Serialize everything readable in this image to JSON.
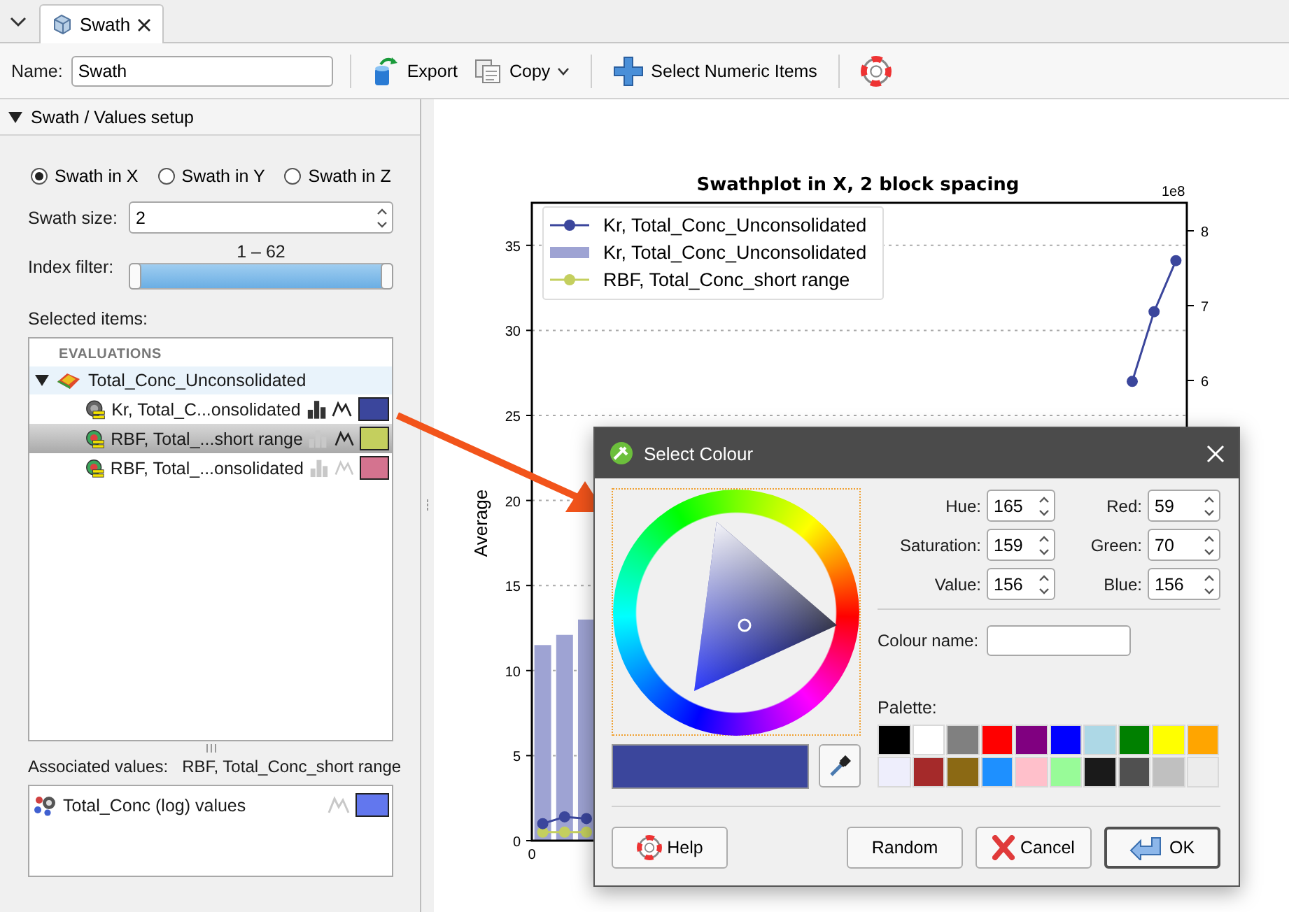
{
  "tab_bar": {
    "tabs": [
      {
        "label": "Swath",
        "selected": true
      }
    ]
  },
  "toolbar": {
    "name_label": "Name:",
    "name_value": "Swath",
    "buttons": [
      {
        "kind": "export",
        "label": "Export"
      },
      {
        "kind": "copy",
        "label": "Copy"
      },
      {
        "kind": "add",
        "label": "Select Numeric Items"
      },
      {
        "kind": "help"
      }
    ]
  },
  "setup_panel": {
    "title": "Swath / Values setup",
    "expanded": true,
    "axis_options": [
      {
        "label": "Swath in X",
        "selected": true
      },
      {
        "label": "Swath in Y",
        "selected": false
      },
      {
        "label": "Swath in Z",
        "selected": false
      }
    ],
    "swath_size": {
      "label": "Swath size:",
      "value": "2"
    },
    "index_filter": {
      "label": "Index filter:",
      "range": "1 – 62",
      "level": 1
    },
    "selected_items": {
      "label": "Selected items:",
      "section": "EVALUATIONS",
      "groups": [
        {
          "label": "Total_Conc_Unconsolidated",
          "expanded": true,
          "children": [
            {
              "label": "Kr, Total_C...onsolidated",
              "kind": "kriging",
              "selected": false,
              "histogram": true,
              "line": true,
              "color": "#3b469c"
            },
            {
              "label": "RBF, Total_...short range",
              "kind": "rbf",
              "selected": true,
              "histogram": false,
              "line": true,
              "color": "#c4cf5e"
            },
            {
              "label": "RBF, Total_...onsolidated",
              "kind": "rbf",
              "selected": false,
              "histogram": false,
              "line": false,
              "color": "#d4738f"
            }
          ]
        }
      ]
    },
    "associated_values": {
      "label": "Associated values:",
      "source": "RBF, Total_Conc_short range",
      "items": [
        {
          "label": "Total_Conc (log) values",
          "line": false,
          "color": "#6277ee"
        }
      ]
    }
  },
  "chart": {
    "right_axis": {
      "multiplier": "1e8",
      "ticks": [
        "8",
        "7",
        "6"
      ]
    },
    "chart_data": {
      "type": "line",
      "title": "Swathplot in X, 2 block spacing",
      "ylabel": "Average",
      "grid": true,
      "legend": true,
      "ylim": [
        0,
        37.5
      ],
      "yticks": [
        0,
        5,
        10,
        15,
        20,
        25,
        30,
        35
      ],
      "annotations": [
        {
          "text": "0"
        }
      ],
      "series": [
        {
          "name": "Kr, Total_Conc_Unconsolidated",
          "color": "#3b469c",
          "marker": "o",
          "values": [
            1.0,
            1.4,
            1.3,
            null,
            null,
            null,
            null,
            null,
            null,
            null,
            null,
            null,
            null,
            null,
            null,
            null,
            null,
            null,
            null,
            null,
            null,
            null,
            null,
            null,
            null,
            null,
            null,
            27.0,
            31.1,
            34.1
          ]
        },
        {
          "name": "Kr, Total_Conc_Unconsolidated",
          "type": "bar",
          "color": "#9ea3d3",
          "values": [
            11.5,
            12.1,
            13.0,
            null,
            null,
            null,
            null,
            null,
            null,
            null,
            null,
            null,
            null,
            null,
            null,
            null,
            null,
            null,
            null,
            null,
            null,
            null,
            null,
            null,
            null,
            null,
            null,
            null,
            null,
            null
          ]
        },
        {
          "name": "RBF, Total_Conc_short range",
          "color": "#c4cf5e",
          "marker": "o",
          "values": [
            0.5,
            0.5,
            0.5,
            null,
            null,
            null,
            null,
            null,
            null,
            null,
            null,
            null,
            null,
            null,
            null,
            null,
            null,
            null,
            null,
            null,
            null,
            null,
            null,
            null,
            null,
            null,
            null,
            null,
            null,
            null
          ]
        }
      ]
    }
  },
  "dialog": {
    "title": "Select Colour",
    "hsv_fields": [
      {
        "label": "Hue:",
        "value": "165"
      },
      {
        "label": "Saturation:",
        "value": "159"
      },
      {
        "label": "Value:",
        "value": "156"
      }
    ],
    "rgb_fields": [
      {
        "label": "Red:",
        "value": "59"
      },
      {
        "label": "Green:",
        "value": "70"
      },
      {
        "label": "Blue:",
        "value": "156"
      }
    ],
    "preview": {
      "color": "#3b469c"
    },
    "colour_name": {
      "label": "Colour name:"
    },
    "palette": {
      "label": "Palette:",
      "swatches": [
        {
          "color": "#000000"
        },
        {
          "color": "#ffffff"
        },
        {
          "color": "#808080"
        },
        {
          "color": "#ff0000"
        },
        {
          "color": "#800080"
        },
        {
          "color": "#0000ff"
        },
        {
          "color": "#add8e6"
        },
        {
          "color": "#008000"
        },
        {
          "color": "#ffff00"
        },
        {
          "color": "#ffa500"
        },
        {
          "color": "#eeeefc"
        },
        {
          "color": "#a52a2a"
        },
        {
          "color": "#8b6914"
        },
        {
          "color": "#1e90ff"
        },
        {
          "color": "#ffc0cb"
        },
        {
          "color": "#98fb98"
        },
        {
          "color": "#1a1a1a"
        },
        {
          "color": "#505050"
        },
        {
          "color": "#c0c0c0"
        },
        {
          "color": "#ececec"
        }
      ]
    },
    "buttons": [
      {
        "kind": "help",
        "label": "Help",
        "default": false
      },
      {
        "kind": "random",
        "label": "Random",
        "default": false
      },
      {
        "kind": "cancel",
        "label": "Cancel",
        "default": false
      },
      {
        "kind": "ok",
        "label": "OK",
        "default": true
      }
    ]
  }
}
